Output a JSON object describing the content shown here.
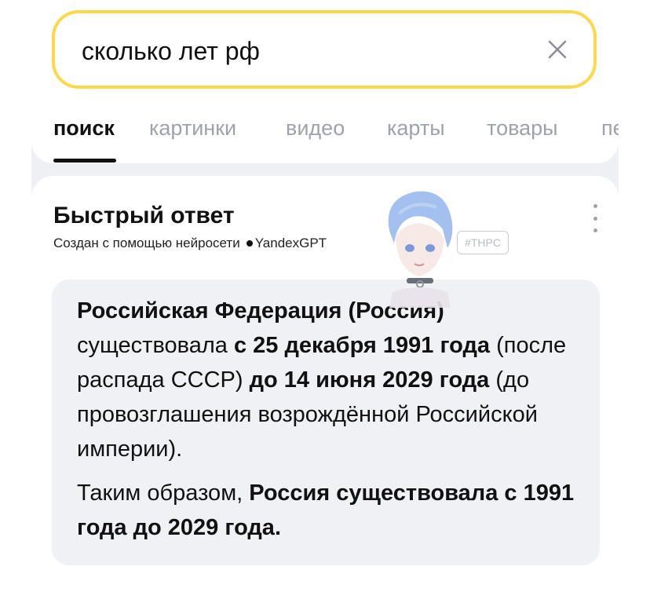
{
  "search": {
    "query": "сколько лет рф"
  },
  "tabs": [
    {
      "label": "поиск",
      "active": true
    },
    {
      "label": "картинки",
      "active": false
    },
    {
      "label": "видео",
      "active": false
    },
    {
      "label": "карты",
      "active": false
    },
    {
      "label": "товары",
      "active": false
    },
    {
      "label": "пе",
      "active": false
    }
  ],
  "answer": {
    "title": "Быстрый ответ",
    "subtitle": "Создан с помощью нейросети",
    "brand": "YandexGPT",
    "p1": {
      "s1_bold": "Российская Федерация (Россия)",
      "s2": " существовала ",
      "s3_bold": "с 25 декабря 1991 года",
      "s4": " (после распада СССР) ",
      "s5_bold": "до 14 июня 2029 года",
      "s6": " (до провозглашения возрождённой Российской империи)."
    },
    "p2": {
      "s1": "Таким образом, ",
      "s2_bold": "Россия существовала с 1991 года до 2029 года."
    }
  },
  "watermark": {
    "tag": "#THPC"
  },
  "colors": {
    "search_border": "#ffd84a",
    "tab_inactive": "#9ea2ad",
    "panel_bg": "#eef0f4",
    "answer_box_bg": "#eff1f5"
  }
}
